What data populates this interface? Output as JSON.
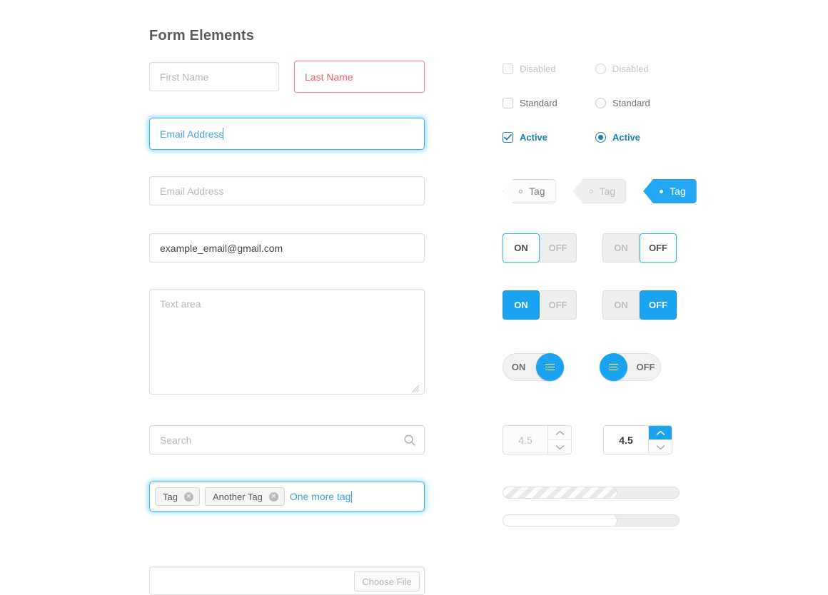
{
  "page_title": "Form Elements",
  "left_column": {
    "first_name": {
      "placeholder": "First Name",
      "value": ""
    },
    "last_name": {
      "placeholder": "Last Name",
      "value": "",
      "state": "error"
    },
    "email_focused": {
      "placeholder": "Email Address",
      "value": "",
      "state": "focused"
    },
    "email_plain": {
      "placeholder": "Email Address",
      "value": ""
    },
    "email_filled": {
      "placeholder": "",
      "value": "example_email@gmail.com"
    },
    "textarea": {
      "placeholder": "Text area",
      "value": ""
    },
    "search": {
      "placeholder": "Search",
      "value": "",
      "icon": "search-icon"
    },
    "tag_input": {
      "chips": [
        {
          "label": "Tag",
          "remove_icon": "close-circle-icon"
        },
        {
          "label": "Another Tag",
          "remove_icon": "close-circle-icon"
        }
      ],
      "typing_value": "One more tag"
    },
    "file_field": {
      "value": "",
      "button_label": "Choose File"
    }
  },
  "right_column": {
    "checkboxes": [
      {
        "label": "Disabled",
        "state": "disabled",
        "checked": false
      },
      {
        "label": "Standard",
        "state": "standard",
        "checked": false
      },
      {
        "label": "Active",
        "state": "active",
        "checked": true
      }
    ],
    "radios": [
      {
        "label": "Disabled",
        "state": "disabled",
        "selected": false
      },
      {
        "label": "Standard",
        "state": "standard",
        "selected": false
      },
      {
        "label": "Active",
        "state": "active",
        "selected": true
      }
    ],
    "tag_pills": [
      {
        "label": "Tag",
        "state": "standard"
      },
      {
        "label": "Tag",
        "state": "disabled"
      },
      {
        "label": "Tag",
        "state": "active"
      }
    ],
    "toggles": [
      {
        "on_label": "ON",
        "off_label": "OFF",
        "selected": "on",
        "style": "outline"
      },
      {
        "on_label": "ON",
        "off_label": "OFF",
        "selected": "off",
        "style": "outline"
      },
      {
        "on_label": "ON",
        "off_label": "OFF",
        "selected": "on",
        "style": "fill"
      },
      {
        "on_label": "ON",
        "off_label": "OFF",
        "selected": "off",
        "style": "fill"
      }
    ],
    "switches": [
      {
        "label": "ON",
        "knob_side": "right"
      },
      {
        "label": "OFF",
        "knob_side": "left"
      }
    ],
    "steppers": [
      {
        "value": "4.5",
        "state": "disabled",
        "up_icon": "chevron-up-icon",
        "down_icon": "chevron-down-icon"
      },
      {
        "value": "4.5",
        "state": "active",
        "up_icon": "chevron-up-icon",
        "down_icon": "chevron-down-icon"
      }
    ],
    "progress_bars": [
      {
        "style": "striped",
        "percent": 65
      },
      {
        "style": "plain",
        "percent": 65
      }
    ]
  },
  "colors": {
    "accent_blue": "#1aa3f0",
    "focus_blue": "#3ab6e8",
    "active_teal": "#1b7fa8",
    "error_red": "#e8616e",
    "text_dark": "#4a4a4a",
    "muted_grey": "#b6b8ba"
  }
}
